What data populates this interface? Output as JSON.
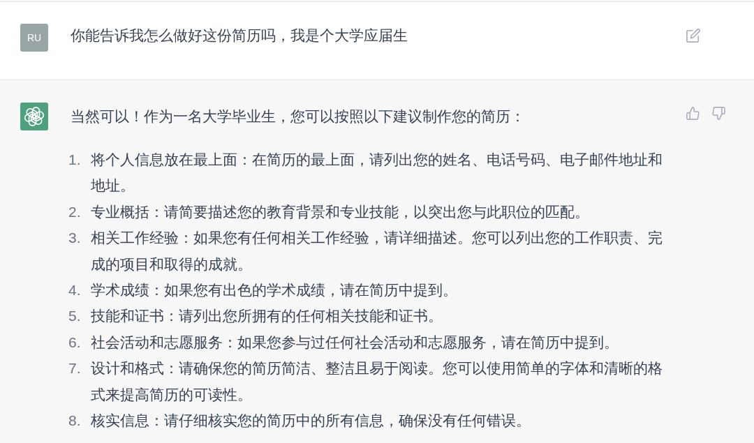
{
  "user_message": {
    "avatar_initials": "RU",
    "text": "你能告诉我怎么做好这份简历吗，我是个大学应届生"
  },
  "assistant_message": {
    "intro": "当然可以！作为一名大学毕业生，您可以按照以下建议制作您的简历：",
    "items": [
      {
        "number": "1.",
        "text": "将个人信息放在最上面：在简历的最上面，请列出您的姓名、电话号码、电子邮件地址和地址。"
      },
      {
        "number": "2.",
        "text": "专业概括：请简要描述您的教育背景和专业技能，以突出您与此职位的匹配。"
      },
      {
        "number": "3.",
        "text": "相关工作经验：如果您有任何相关工作经验，请详细描述。您可以列出您的工作职责、完成的项目和取得的成就。"
      },
      {
        "number": "4.",
        "text": "学术成绩：如果您有出色的学术成绩，请在简历中提到。"
      },
      {
        "number": "5.",
        "text": "技能和证书：请列出您所拥有的任何相关技能和证书。"
      },
      {
        "number": "6.",
        "text": "社会活动和志愿服务：如果您参与过任何社会活动和志愿服务，请在简历中提到。"
      },
      {
        "number": "7.",
        "text": "设计和格式：请确保您的简历简洁、整洁且易于阅读。您可以使用简单的字体和清晰的格式来提高简历的可读性。"
      },
      {
        "number": "8.",
        "text": "核实信息：请仔细核实您的简历中的所有信息，确保没有任何错误。"
      }
    ]
  }
}
